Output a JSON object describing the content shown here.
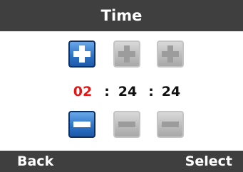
{
  "header": {
    "title": "Time"
  },
  "time": {
    "hours": "02",
    "minutes": "24",
    "seconds": "24",
    "separator": ":",
    "selected_field": "hours"
  },
  "increment_buttons": [
    {
      "icon": "plus-icon",
      "state": "active"
    },
    {
      "icon": "plus-icon",
      "state": "inactive"
    },
    {
      "icon": "plus-icon",
      "state": "inactive"
    }
  ],
  "decrement_buttons": [
    {
      "icon": "minus-icon",
      "state": "active"
    },
    {
      "icon": "minus-icon",
      "state": "inactive"
    },
    {
      "icon": "minus-icon",
      "state": "inactive"
    }
  ],
  "softkeys": {
    "left": "Back",
    "right": "Select"
  },
  "colors": {
    "bar_background": "#3f3f3f",
    "active_button": "#2f74c8",
    "inactive_button": "#bdbdbd",
    "selected_value": "#e01818"
  }
}
